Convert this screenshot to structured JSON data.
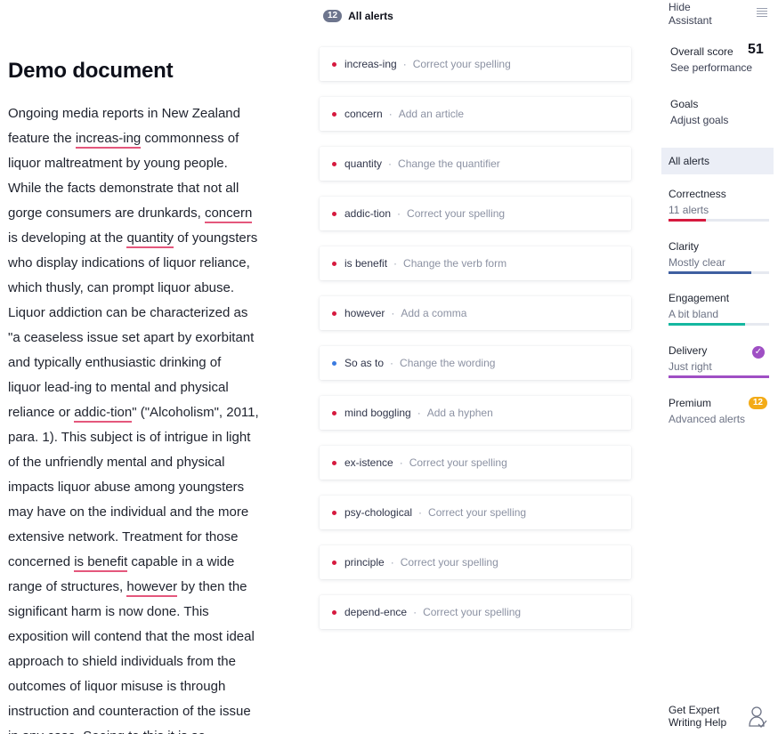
{
  "document": {
    "title": "Demo document",
    "lines": [
      [
        {
          "t": "Ongoing media reports in New Zealand"
        }
      ],
      [
        {
          "t": "feature the "
        },
        {
          "t": "increas-ing",
          "e": 1
        },
        {
          "t": " commonness of"
        }
      ],
      [
        {
          "t": "liquor maltreatment by young people."
        }
      ],
      [
        {
          "t": "While the facts demonstrate that not all"
        }
      ],
      [
        {
          "t": "gorge consumers are drunkards, "
        },
        {
          "t": "concern",
          "e": 1
        }
      ],
      [
        {
          "t": "is developing at the "
        },
        {
          "t": "quantity",
          "e": 1
        },
        {
          "t": " of youngsters"
        }
      ],
      [
        {
          "t": "who display indications of liquor reliance,"
        }
      ],
      [
        {
          "t": "which thusly, can prompt liquor abuse."
        }
      ],
      [
        {
          "t": "Liquor addiction can be characterized as"
        }
      ],
      [
        {
          "t": "\"a ceaseless issue set apart by exorbitant"
        }
      ],
      [
        {
          "t": "and typically enthusiastic drinking of"
        }
      ],
      [
        {
          "t": "liquor lead-ing to mental and physical"
        }
      ],
      [
        {
          "t": "reliance or "
        },
        {
          "t": "addic-tion",
          "e": 1
        },
        {
          "t": "\" (\"Alcoholism\", 2011,"
        }
      ],
      [
        {
          "t": "para. 1). This subject is of intrigue in light"
        }
      ],
      [
        {
          "t": "of the unfriendly mental and physical"
        }
      ],
      [
        {
          "t": "impacts liquor abuse among youngsters"
        }
      ],
      [
        {
          "t": "may have on the individual and the more"
        }
      ],
      [
        {
          "t": "extensive network. Treatment for those"
        }
      ],
      [
        {
          "t": "concerned "
        },
        {
          "t": "is benefit",
          "e": 1
        },
        {
          "t": " capable in a wide"
        }
      ],
      [
        {
          "t": "range of structures, "
        },
        {
          "t": "however",
          "e": 1
        },
        {
          "t": " by then the"
        }
      ],
      [
        {
          "t": "significant harm is now done. This"
        }
      ],
      [
        {
          "t": "exposition will contend that the most ideal"
        }
      ],
      [
        {
          "t": "approach to shield individuals from the"
        }
      ],
      [
        {
          "t": "outcomes of liquor misuse is through"
        }
      ],
      [
        {
          "t": "instruction and counteraction of the issue"
        }
      ],
      [
        {
          "t": "in any case. Seeing to this it is so"
        }
      ]
    ]
  },
  "alerts_panel": {
    "count": "12",
    "title": "All alerts",
    "items": [
      {
        "word": "increas-ing",
        "hint": "Correct your spelling",
        "dot": "red"
      },
      {
        "word": "concern",
        "hint": "Add an article",
        "dot": "red"
      },
      {
        "word": "quantity",
        "hint": "Change the quantifier",
        "dot": "red"
      },
      {
        "word": "addic-tion",
        "hint": "Correct your spelling",
        "dot": "red"
      },
      {
        "word": "is benefit",
        "hint": "Change the verb form",
        "dot": "red"
      },
      {
        "word": "however",
        "hint": "Add a comma",
        "dot": "red"
      },
      {
        "word": "So as to",
        "hint": "Change the wording",
        "dot": "blue"
      },
      {
        "word": "mind boggling",
        "hint": "Add a hyphen",
        "dot": "red"
      },
      {
        "word": "ex-istence",
        "hint": "Correct your spelling",
        "dot": "red"
      },
      {
        "word": "psy-chological",
        "hint": "Correct your spelling",
        "dot": "red"
      },
      {
        "word": "principle",
        "hint": "Correct your spelling",
        "dot": "red"
      },
      {
        "word": "depend-ence",
        "hint": "Correct your spelling",
        "dot": "red"
      }
    ],
    "separator": "·"
  },
  "assistant": {
    "hide_label_1": "Hide",
    "hide_label_2": "Assistant",
    "overall_label": "Overall score",
    "overall_value": "51",
    "see_performance": "See performance",
    "goals_label": "Goals",
    "adjust_goals": "Adjust goals",
    "all_alerts": "All alerts",
    "categories": [
      {
        "name": "Correctness",
        "sub": "11 alerts",
        "color": "#d6193e",
        "level": 0.37
      },
      {
        "name": "Clarity",
        "sub": "Mostly clear",
        "color": "#3f5fa0",
        "level": 0.82
      },
      {
        "name": "Engagement",
        "sub": "A bit bland",
        "color": "#15b7a0",
        "level": 0.76
      },
      {
        "name": "Delivery",
        "sub": "Just right",
        "color": "#9f4fc4",
        "level": 1.0
      }
    ],
    "delivery_check": "✓",
    "premium_label": "Premium",
    "premium_sub": "Advanced alerts",
    "premium_count": "12",
    "expert_1": "Get Expert",
    "expert_2": "Writing Help"
  }
}
